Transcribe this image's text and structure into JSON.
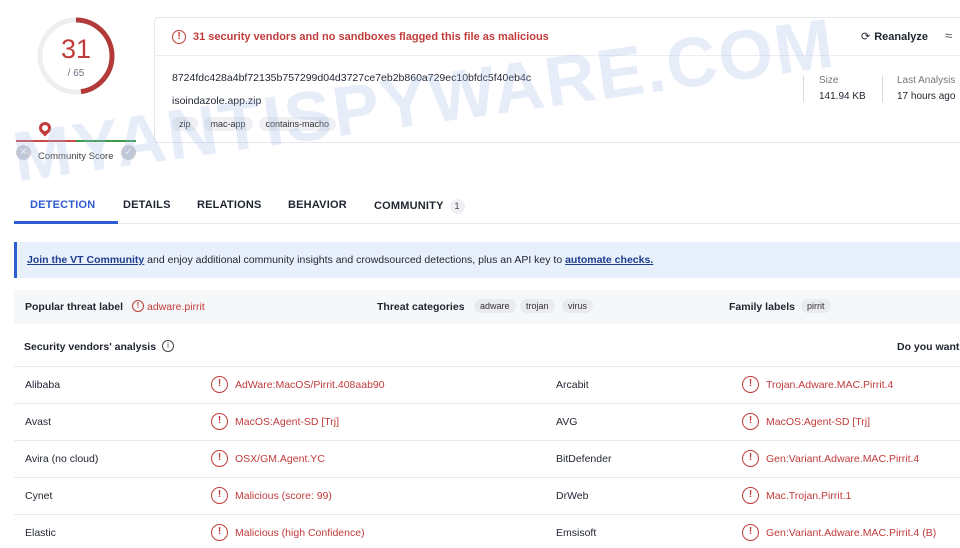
{
  "score": {
    "detections": "31",
    "total": "/ 65",
    "detected_fraction": 0.477
  },
  "community": {
    "label": "Community Score"
  },
  "alert": {
    "text": "31 security vendors and no sandboxes flagged this file as malicious"
  },
  "actions": {
    "reanalyze": "Reanalyze",
    "similar": "≈"
  },
  "file": {
    "hash": "8724fdc428a4bf72135b757299d04d3727ce7eb2b860a729ec10bfdc5f40eb4c",
    "name": "isoindazole.app.zip",
    "tags": [
      "zip",
      "mac-app",
      "contains-macho"
    ],
    "size_label": "Size",
    "size_value": "141.94 KB",
    "last_label": "Last Analysis",
    "last_value": "17 hours ago"
  },
  "watermark": "MYANTISPYWARE.COM",
  "tabs": [
    {
      "label": "DETECTION"
    },
    {
      "label": "DETAILS"
    },
    {
      "label": "RELATIONS"
    },
    {
      "label": "BEHAVIOR"
    },
    {
      "label": "COMMUNITY",
      "badge": "1"
    }
  ],
  "banner": {
    "link1": "Join the VT Community",
    "middle": " and enjoy additional community insights and crowdsourced detections, plus an API key to ",
    "link2": "automate checks."
  },
  "threat": {
    "popular_label": "Popular threat label",
    "popular_value": "adware.pirrit",
    "categories_label": "Threat categories",
    "categories": [
      "adware",
      "trojan",
      "virus"
    ],
    "family_label": "Family labels",
    "families": [
      "pirrit"
    ]
  },
  "vendors_header": {
    "title": "Security vendors' analysis",
    "right": "Do you want"
  },
  "vendors": [
    [
      {
        "name": "Alibaba",
        "result": "AdWare:MacOS/Pirrit.408aab90"
      },
      {
        "name": "Arcabit",
        "result": "Trojan.Adware.MAC.Pirrit.4"
      }
    ],
    [
      {
        "name": "Avast",
        "result": "MacOS:Agent-SD [Trj]"
      },
      {
        "name": "AVG",
        "result": "MacOS:Agent-SD [Trj]"
      }
    ],
    [
      {
        "name": "Avira (no cloud)",
        "result": "OSX/GM.Agent.YC"
      },
      {
        "name": "BitDefender",
        "result": "Gen:Variant.Adware.MAC.Pirrit.4"
      }
    ],
    [
      {
        "name": "Cynet",
        "result": "Malicious (score: 99)"
      },
      {
        "name": "DrWeb",
        "result": "Mac.Trojan.Pirrit.1"
      }
    ],
    [
      {
        "name": "Elastic",
        "result": "Malicious (high Confidence)"
      },
      {
        "name": "Emsisoft",
        "result": "Gen:Variant.Adware.MAC.Pirrit.4 (B)"
      }
    ]
  ],
  "colors": {
    "malicious": "#c13b3b",
    "accent": "#2f5bd3",
    "banner_bg": "#e8f0fb"
  },
  "icons": {
    "alert": "alert-circle-icon",
    "reanalyze": "refresh-icon",
    "similar": "approx-icon"
  }
}
